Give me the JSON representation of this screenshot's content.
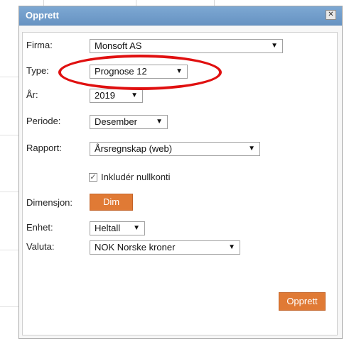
{
  "dialog": {
    "title": "Opprett",
    "close_glyph": "✕"
  },
  "form": {
    "firma": {
      "label": "Firma:",
      "value": "Monsoft AS"
    },
    "type": {
      "label": "Type:",
      "value": "Prognose 12"
    },
    "ar": {
      "label": "År:",
      "value": "2019"
    },
    "periode": {
      "label": "Periode:",
      "value": "Desember"
    },
    "rapport": {
      "label": "Rapport:",
      "value": "Årsregnskap (web)"
    },
    "nullkonti": {
      "label": "Inkludér nullkonti",
      "checked": true
    },
    "dimensjon": {
      "label": "Dimensjon:",
      "button": "Dim"
    },
    "enhet": {
      "label": "Enhet:",
      "value": "Heltall"
    },
    "valuta": {
      "label": "Valuta:",
      "value": "NOK Norske kroner"
    }
  },
  "actions": {
    "create_label": "Opprett"
  },
  "dropdown_arrow": "▼",
  "colors": {
    "titlebar": "#7da8d3",
    "accent_button": "#e07a35",
    "annotation": "#e01010"
  }
}
